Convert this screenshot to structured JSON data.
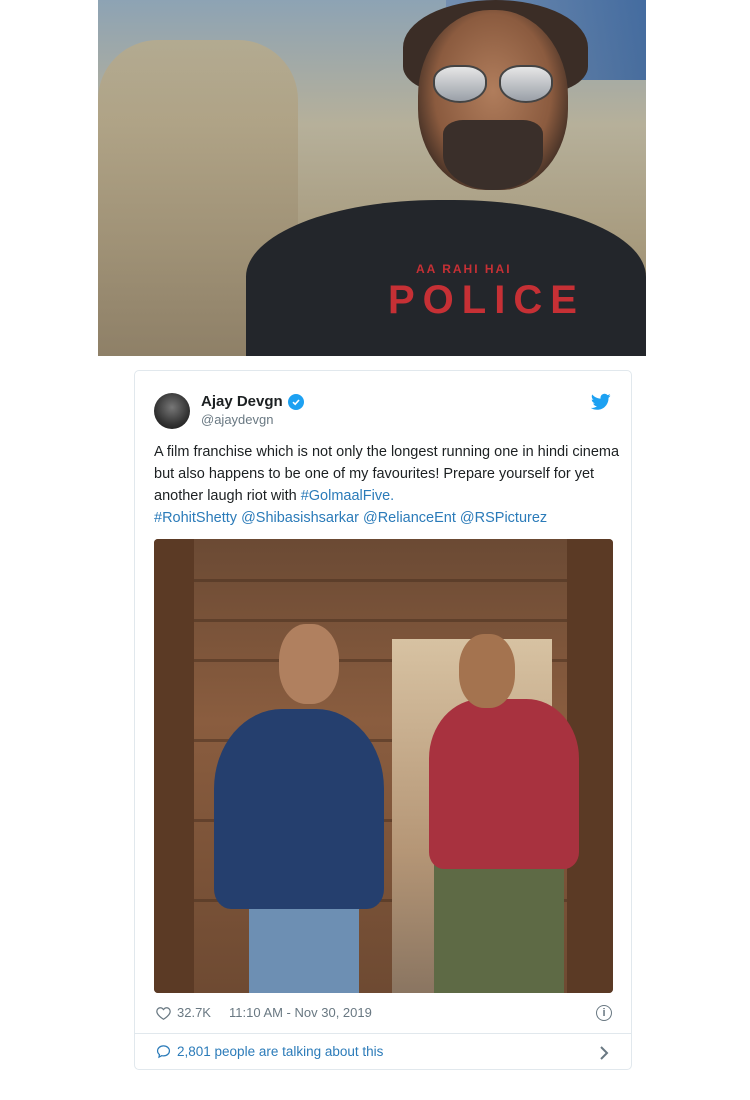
{
  "top_photo": {
    "shirt_line1": "AA RAHI HAI",
    "shirt_line2": "POLICE"
  },
  "tweet": {
    "author_name": "Ajay Devgn",
    "handle": "@ajaydevgn",
    "text_plain_1": "A film franchise which is not only the longest running one in hindi cinema but also happens to be one of my favourites! Prepare yourself for yet another laugh riot with ",
    "hashtag_1": "#GolmaalFive.",
    "hashtag_2": "#RohitShetty",
    "mention_1": "@Shibasishsarkar",
    "mention_2": "@RelianceEnt",
    "mention_3": "@RSPicturez",
    "likes": "32.7K",
    "timestamp": "11:10 AM - Nov 30, 2019",
    "talking": "2,801 people are talking about this"
  },
  "icons": {
    "verified": "verified-icon",
    "bird": "twitter-bird-icon",
    "heart": "heart-icon",
    "info": "info-icon",
    "comment": "comment-icon",
    "chevron": "chevron-right-icon"
  },
  "colors": {
    "link": "#2b7bb9",
    "twitter_blue": "#1da1f2",
    "muted": "#697882"
  }
}
